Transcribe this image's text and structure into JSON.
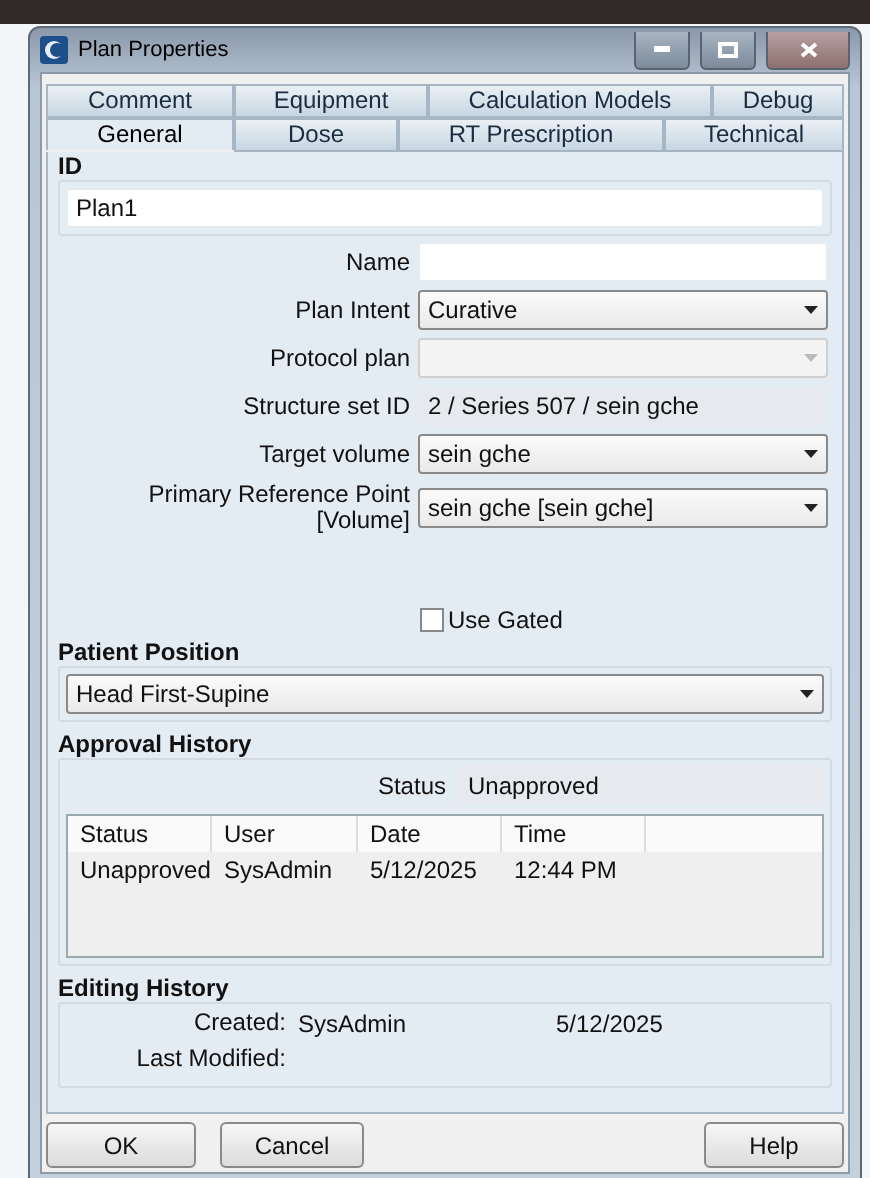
{
  "window": {
    "title": "Plan Properties"
  },
  "tab_rows": [
    [
      {
        "label": "Comment",
        "selected": false
      },
      {
        "label": "Equipment",
        "selected": false
      },
      {
        "label": "Calculation Models",
        "selected": false
      },
      {
        "label": "Debug",
        "selected": false
      }
    ],
    [
      {
        "label": "General",
        "selected": true
      },
      {
        "label": "Dose",
        "selected": false
      },
      {
        "label": "RT Prescription",
        "selected": false
      },
      {
        "label": "Technical",
        "selected": false
      }
    ]
  ],
  "id_group": {
    "title": "ID",
    "value": "Plan1"
  },
  "fields": [
    {
      "label": "Name",
      "kind": "text"
    },
    {
      "label": "Plan Intent",
      "kind": "select",
      "value": "Curative"
    },
    {
      "label": "Protocol plan",
      "kind": "disabled-select"
    },
    {
      "label": "Structure set ID",
      "kind": "readonly",
      "value": "2 / Series 507 / sein gche"
    },
    {
      "label": "Target volume",
      "kind": "select",
      "value": "sein gche"
    },
    {
      "label": "Primary Reference Point [Volume]",
      "kind": "select",
      "value": "sein gche  [sein gche]"
    }
  ],
  "use_gated": {
    "label": "Use Gated",
    "checked": false
  },
  "patient_position": {
    "title": "Patient Position",
    "value": "Head First-Supine"
  },
  "approval_history": {
    "title": "Approval History",
    "status_label": "Status",
    "status_value": "Unapproved",
    "columns": [
      "Status",
      "User",
      "Date",
      "Time"
    ],
    "rows": [
      [
        "Unapproved",
        "SysAdmin",
        "5/12/2025",
        "12:44 PM"
      ]
    ]
  },
  "editing_history": {
    "title": "Editing History",
    "created_label": "Created:",
    "created_user": "SysAdmin",
    "created_date": "5/12/2025",
    "modified_label": "Last Modified:"
  },
  "buttons": {
    "left": [
      "OK",
      "Cancel"
    ],
    "right": [
      "Help"
    ]
  }
}
